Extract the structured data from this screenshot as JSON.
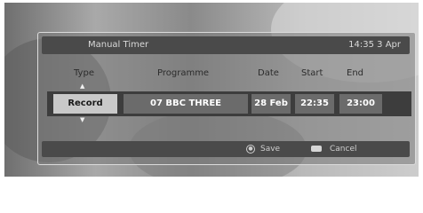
{
  "header": {
    "title": "Manual Timer",
    "clock": "14:35  3  Apr"
  },
  "columns": {
    "type": "Type",
    "programme": "Programme",
    "date": "Date",
    "start": "Start",
    "end": "End"
  },
  "row": {
    "type": "Record",
    "programme": "07 BBC THREE",
    "date": "28 Feb",
    "start": "22:35",
    "end": "23:00"
  },
  "footer": {
    "save_label": "Save",
    "cancel_label": "Cancel"
  },
  "icons": {
    "up": "arrow-up-icon",
    "down": "arrow-down-icon",
    "save": "ok-button-icon",
    "cancel": "return-button-icon"
  }
}
